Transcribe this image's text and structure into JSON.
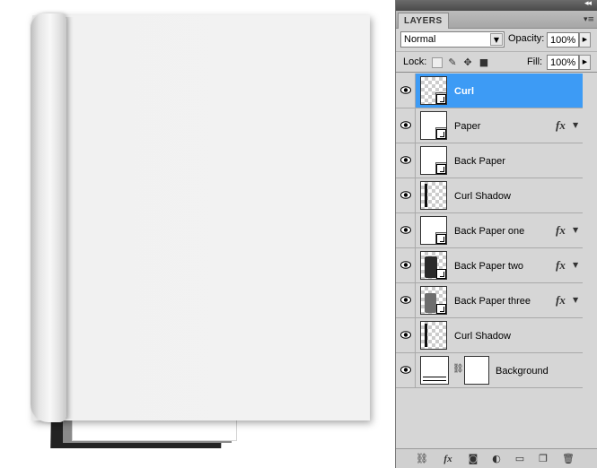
{
  "panel": {
    "tab_label": "LAYERS",
    "collapse_glyph": "◂◂",
    "menu_glyph": "▾≡",
    "blend_mode": "Normal",
    "opacity_label": "Opacity:",
    "opacity_value": "100%",
    "lock_label": "Lock:",
    "fill_label": "Fill:",
    "fill_value": "100%"
  },
  "layers": [
    {
      "name": "Curl",
      "selected": true,
      "fx": false
    },
    {
      "name": "Paper",
      "selected": false,
      "fx": true
    },
    {
      "name": "Back Paper",
      "selected": false,
      "fx": false
    },
    {
      "name": "Curl Shadow",
      "selected": false,
      "fx": false
    },
    {
      "name": "Back Paper one",
      "selected": false,
      "fx": true
    },
    {
      "name": "Back Paper two",
      "selected": false,
      "fx": true
    },
    {
      "name": "Back Paper three",
      "selected": false,
      "fx": true
    },
    {
      "name": "Curl Shadow",
      "selected": false,
      "fx": false
    },
    {
      "name": "Background",
      "selected": false,
      "fx": false
    }
  ],
  "fx_label": "fx",
  "colors": {
    "selection": "#3d9bf5",
    "panel_bg": "#d6d6d6"
  }
}
